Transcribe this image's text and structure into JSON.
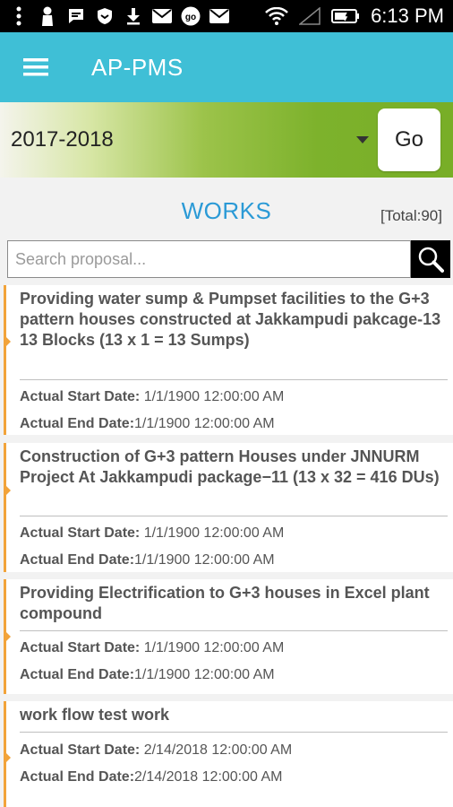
{
  "status_bar": {
    "time": "6:13 PM",
    "icons": [
      "menu-dots-icon",
      "person-icon",
      "message-icon",
      "shield-icon",
      "download-icon",
      "mail-icon",
      "go-icon",
      "mail-icon",
      "wifi-icon",
      "signal-icon",
      "battery-icon"
    ]
  },
  "app_bar": {
    "title": "AP-PMS",
    "menu_icon": "hamburger-icon"
  },
  "filter": {
    "year": "2017-2018",
    "go_label": "Go"
  },
  "works": {
    "heading": "WORKS",
    "total": "[Total:90]"
  },
  "search": {
    "placeholder": "Search proposal...",
    "value": "",
    "icon": "search-icon"
  },
  "labels": {
    "start": "Actual Start Date: ",
    "end": "Actual End Date:"
  },
  "items": [
    {
      "title": "Providing water sump & Pumpset facilities to the G+3 pattern houses constructed at Jakkampudi pakcage-13\n13 Blocks (13 x 1 = 13 Sumps)",
      "start_date": "1/1/1900 12:00:00 AM",
      "end_date": "1/1/1900 12:00:00 AM"
    },
    {
      "title": "Construction of  G+3 pattern  Houses under JNNURM Project At Jakkampudi package−11 (13 x 32 = 416 DUs)",
      "start_date": "1/1/1900 12:00:00 AM",
      "end_date": "1/1/1900 12:00:00 AM"
    },
    {
      "title": "Providing Electrification to G+3 houses in Excel plant compound",
      "start_date": "1/1/1900 12:00:00 AM",
      "end_date": "1/1/1900 12:00:00 AM"
    },
    {
      "title": "work flow test work",
      "start_date": "2/14/2018 12:00:00 AM",
      "end_date": "2/14/2018 12:00:00 AM"
    }
  ]
}
